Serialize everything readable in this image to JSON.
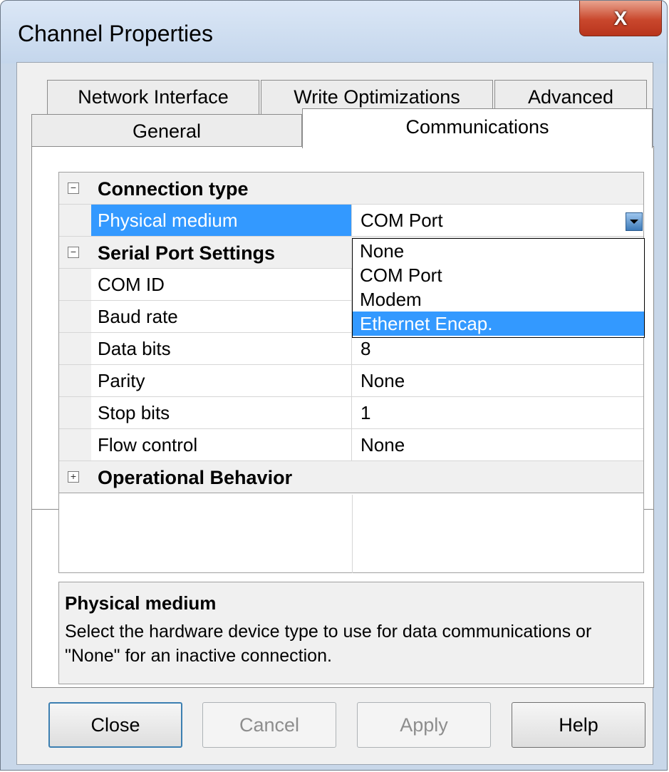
{
  "window": {
    "title": "Channel Properties",
    "close_glyph": "X"
  },
  "tabs": {
    "row1": [
      "Network Interface",
      "Write Optimizations",
      "Advanced"
    ],
    "row2": [
      "General",
      "Communications"
    ],
    "active": "Communications"
  },
  "grid": {
    "category_connection": "Connection type",
    "physical_medium_label": "Physical medium",
    "physical_medium_value": "COM Port",
    "category_serial": "Serial Port Settings",
    "com_id_label": "COM ID",
    "baud_rate_label": "Baud rate",
    "data_bits_label": "Data bits",
    "data_bits_value": "8",
    "parity_label": "Parity",
    "parity_value": "None",
    "stop_bits_label": "Stop bits",
    "stop_bits_value": "1",
    "flow_control_label": "Flow control",
    "flow_control_value": "None",
    "category_operational": "Operational Behavior",
    "collapse_glyph": "−",
    "expand_glyph": "+"
  },
  "dropdown": {
    "options": [
      "None",
      "COM Port",
      "Modem",
      "Ethernet Encap."
    ],
    "highlighted": "Ethernet Encap."
  },
  "help": {
    "title": "Physical medium",
    "text": "Select the hardware device type to use for data communications or \"None\" for an inactive connection."
  },
  "buttons": {
    "close": "Close",
    "cancel": "Cancel",
    "apply": "Apply",
    "help": "Help"
  },
  "colors": {
    "selection": "#3399ff",
    "close_button": "#c9472c"
  }
}
